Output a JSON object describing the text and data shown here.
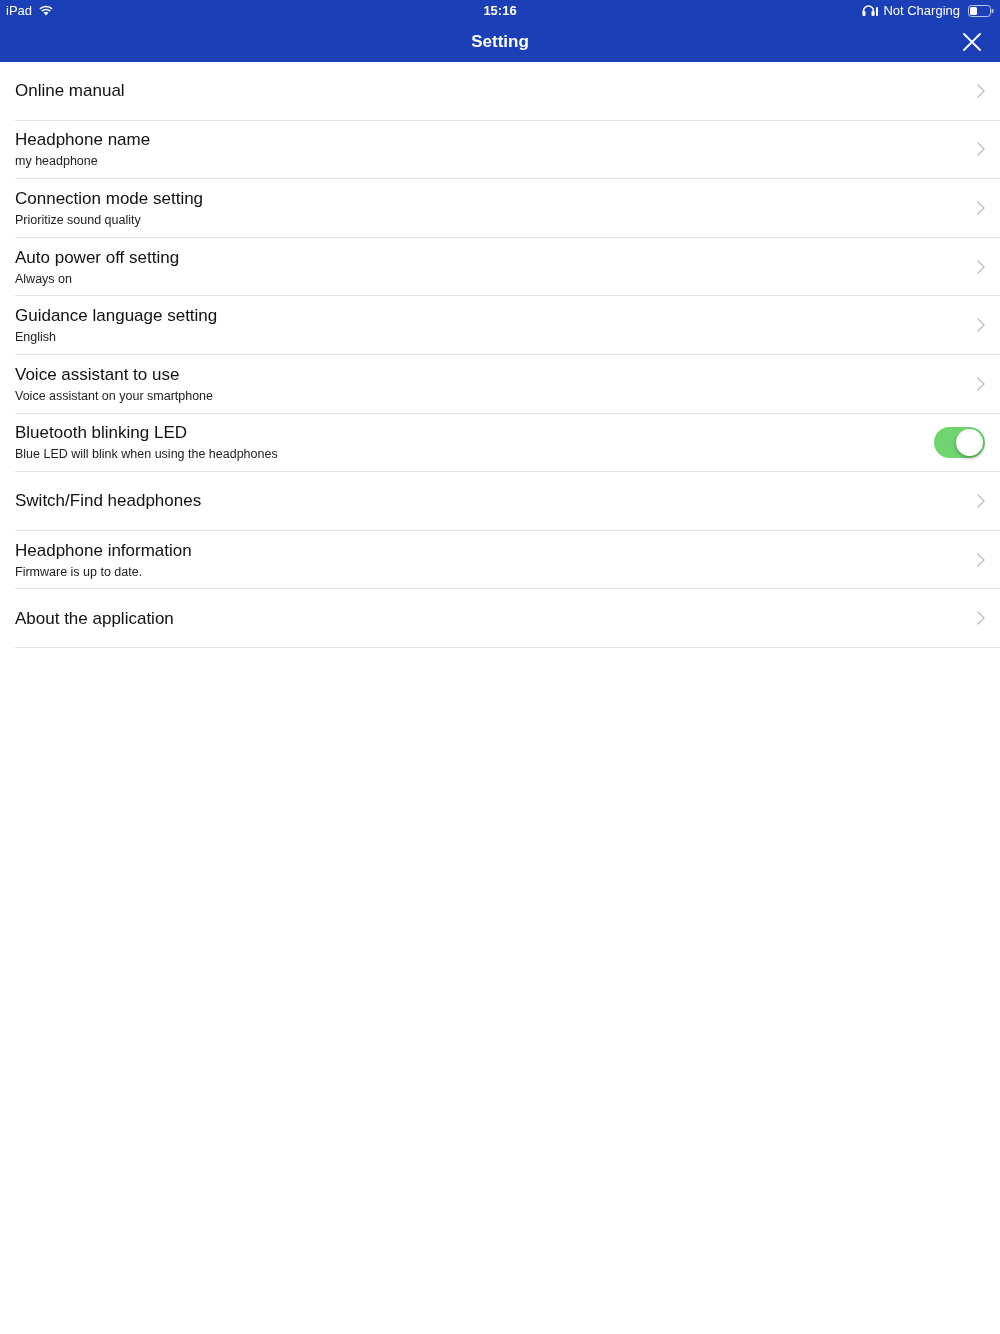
{
  "status_bar": {
    "device": "iPad",
    "time": "15:16",
    "charging": "Not Charging"
  },
  "header": {
    "title": "Setting"
  },
  "items": [
    {
      "kind": "link",
      "title": "Online manual"
    },
    {
      "kind": "link",
      "title": "Headphone name",
      "subtitle": "my headphone"
    },
    {
      "kind": "link",
      "title": "Connection mode setting",
      "subtitle": "Prioritize sound quality"
    },
    {
      "kind": "link",
      "title": "Auto power off setting",
      "subtitle": "Always on"
    },
    {
      "kind": "link",
      "title": "Guidance language setting",
      "subtitle": "English"
    },
    {
      "kind": "link",
      "title": "Voice assistant to use",
      "subtitle": "Voice assistant on your smartphone"
    },
    {
      "kind": "toggle",
      "title": "Bluetooth blinking LED",
      "subtitle": "Blue LED will blink when using the headphones",
      "on": true
    },
    {
      "kind": "link",
      "title": "Switch/Find headphones"
    },
    {
      "kind": "link",
      "title": "Headphone information",
      "subtitle": "Firmware is up to date."
    },
    {
      "kind": "link",
      "title": "About the application"
    }
  ]
}
